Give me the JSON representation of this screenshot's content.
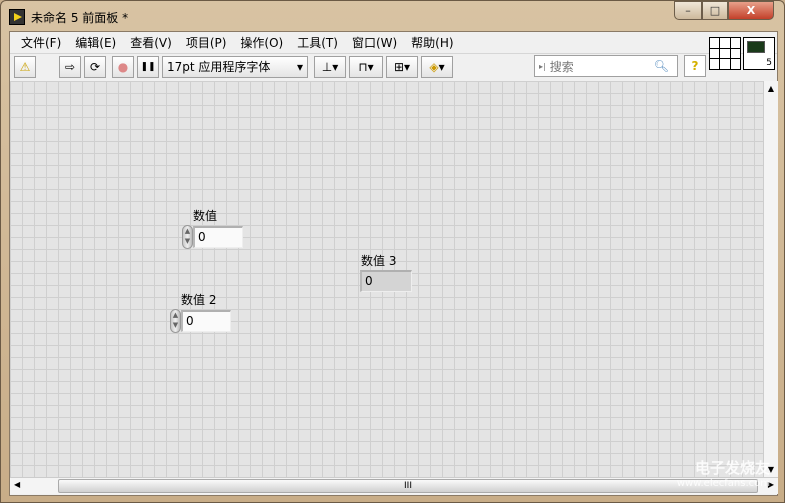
{
  "window": {
    "title": "未命名 5 前面板 *",
    "minimize": "–",
    "maximize": "□",
    "close": "X"
  },
  "menu": [
    "文件(F)",
    "编辑(E)",
    "查看(V)",
    "项目(P)",
    "操作(O)",
    "工具(T)",
    "窗口(W)",
    "帮助(H)"
  ],
  "toolbar": {
    "warning": "⚠",
    "run": "⇨",
    "run_continuous": "⟳",
    "abort": "●",
    "pause": "❚❚",
    "font": "17pt 应用程序字体",
    "font_arrow": "▾",
    "align": "▾",
    "distribute": "▾",
    "resize": "▾",
    "reorder": "▾"
  },
  "search": {
    "placeholder": "搜索",
    "icon": "search-icon"
  },
  "help": "?",
  "vi_icon_number": "5",
  "controls": [
    {
      "label": "数值",
      "value": "0",
      "kind": "control"
    },
    {
      "label": "数值 2",
      "value": "0",
      "kind": "control"
    },
    {
      "label": "数值 3",
      "value": "0",
      "kind": "indicator"
    }
  ],
  "scroll": {
    "up": "▲",
    "down": "▼",
    "left": "◀",
    "right": "▶",
    "grip": "III"
  },
  "watermark": {
    "line1": "电子发烧友",
    "line2": "www.elecfans.com"
  }
}
